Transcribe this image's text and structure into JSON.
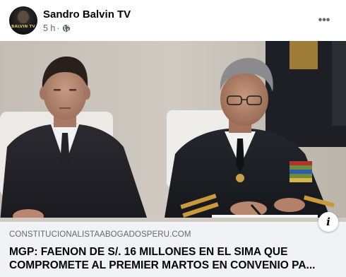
{
  "post": {
    "page_name": "Sandro Balvin TV",
    "timestamp": "5 h",
    "separator": "·",
    "audience_icon": "globe-icon",
    "more_label": "•••",
    "avatar_text": "BALVIN TV"
  },
  "link_preview": {
    "domain": "CONSTITUCIONALISTAABOGADOSPERU.COM",
    "title": "MGP: FAENON DE S/. 16 MILLONES EN EL SIMA QUE COMPROMETE AL PREMIER MARTOS EN CONVENIO PA...",
    "info_icon": "info-icon",
    "info_label": "i"
  },
  "colors": {
    "link_box_bg": "#f0f2f5",
    "secondary_text": "#65676b",
    "primary_text": "#050505"
  }
}
